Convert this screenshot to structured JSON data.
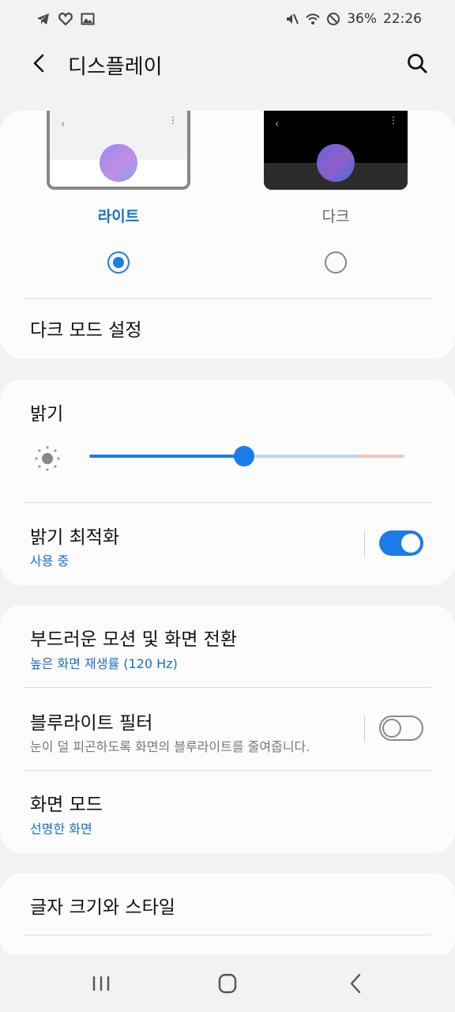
{
  "status": {
    "battery": "36%",
    "time": "22:26"
  },
  "header": {
    "title": "디스플레이"
  },
  "theme": {
    "light_label": "라이트",
    "dark_label": "다크",
    "selected": "light",
    "dark_mode_settings": "다크 모드 설정"
  },
  "brightness": {
    "title": "밝기",
    "level": 0.49,
    "adaptive_title": "밝기 최적화",
    "adaptive_sub": "사용 중",
    "adaptive_on": true
  },
  "motion": {
    "title": "부드러운 모션 및 화면 전환",
    "sub": "높은 화면 재생률 (120 Hz)"
  },
  "bluelight": {
    "title": "블루라이트 필터",
    "sub": "눈이 덜 피곤하도록 화면의 블루라이트를 줄여줍니다.",
    "on": false
  },
  "screen_mode": {
    "title": "화면 모드",
    "sub": "선명한 화면"
  },
  "font": {
    "title": "글자 크기와 스타일"
  },
  "colors": {
    "accent": "#1a7ce8",
    "accent_text": "#1a6fcc"
  },
  "icons": [
    "telegram-icon",
    "heart-icon",
    "gallery-icon",
    "mute-icon",
    "wifi-icon",
    "dnd-icon",
    "back-icon",
    "search-icon",
    "sun-icon",
    "recents-icon",
    "home-icon",
    "nav-back-icon"
  ]
}
